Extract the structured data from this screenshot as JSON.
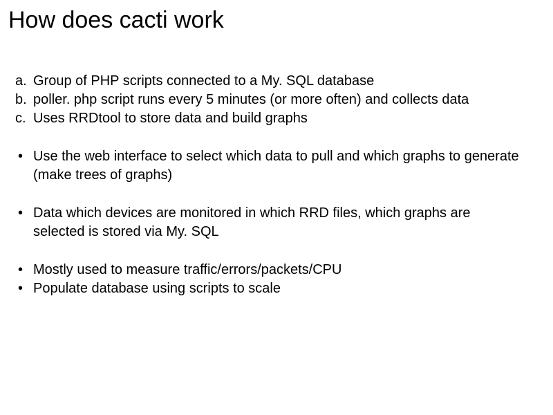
{
  "title": "How does cacti work",
  "ordered": [
    {
      "marker": "a.",
      "text": "Group of PHP scripts connected to a My. SQL database"
    },
    {
      "marker": "b.",
      "text": "poller. php script runs every 5 minutes (or more often) and collects data"
    },
    {
      "marker": "c.",
      "text": "Uses RRDtool to store data and build graphs"
    }
  ],
  "bullets": {
    "group1": [
      "Use the web interface to select which data to pull and which graphs to generate (make trees of graphs)"
    ],
    "group2": [
      "Data which devices are monitored in which RRD files, which graphs are selected is stored via My. SQL"
    ],
    "group3": [
      "Mostly used to measure traffic/errors/packets/CPU",
      "Populate database using scripts to scale"
    ]
  }
}
